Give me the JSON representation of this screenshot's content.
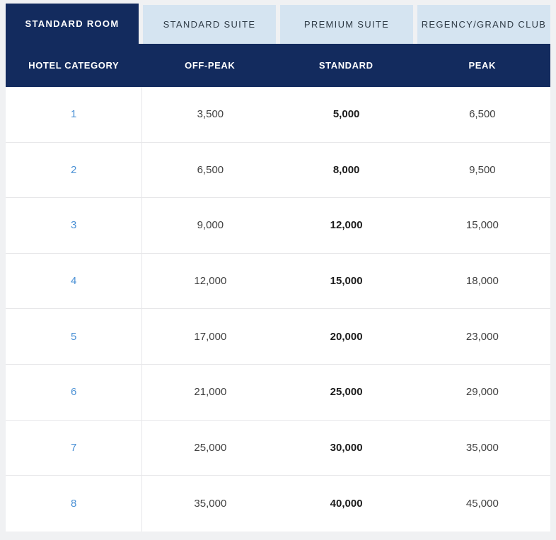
{
  "tabs": [
    {
      "label": "STANDARD ROOM",
      "active": true
    },
    {
      "label": "STANDARD SUITE",
      "active": false
    },
    {
      "label": "PREMIUM SUITE",
      "active": false
    },
    {
      "label": "REGENCY/GRAND CLUB",
      "active": false
    }
  ],
  "table": {
    "columns": [
      "HOTEL CATEGORY",
      "OFF-PEAK",
      "STANDARD",
      "PEAK"
    ],
    "rows": [
      {
        "category": "1",
        "off_peak": "3,500",
        "standard": "5,000",
        "peak": "6,500"
      },
      {
        "category": "2",
        "off_peak": "6,500",
        "standard": "8,000",
        "peak": "9,500"
      },
      {
        "category": "3",
        "off_peak": "9,000",
        "standard": "12,000",
        "peak": "15,000"
      },
      {
        "category": "4",
        "off_peak": "12,000",
        "standard": "15,000",
        "peak": "18,000"
      },
      {
        "category": "5",
        "off_peak": "17,000",
        "standard": "20,000",
        "peak": "23,000"
      },
      {
        "category": "6",
        "off_peak": "21,000",
        "standard": "25,000",
        "peak": "29,000"
      },
      {
        "category": "7",
        "off_peak": "25,000",
        "standard": "30,000",
        "peak": "35,000"
      },
      {
        "category": "8",
        "off_peak": "35,000",
        "standard": "40,000",
        "peak": "45,000"
      }
    ]
  },
  "colors": {
    "brand_navy": "#132b5e",
    "tab_inactive_bg": "#d5e4f1",
    "tab_inactive_text": "#2f3b46",
    "link_blue": "#4b91d5",
    "row_divider": "#e7e7e9",
    "page_background": "#f0f1f3",
    "cell_text": "#404040",
    "cell_text_bold": "#1c1c1c"
  }
}
